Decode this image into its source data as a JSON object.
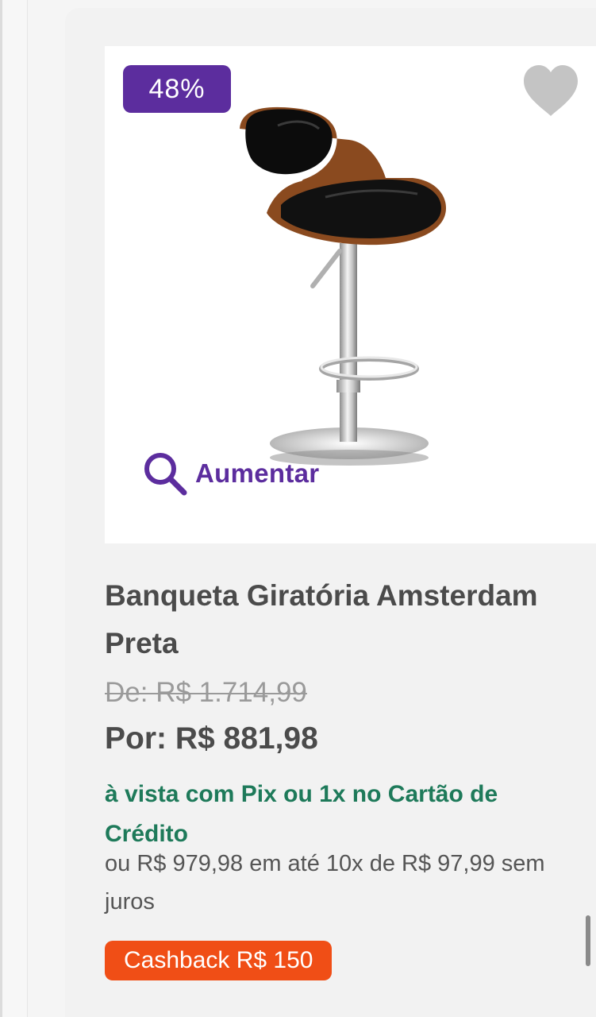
{
  "product": {
    "discount_badge": "48%",
    "zoom_label": "Aumentar",
    "title": "Banqueta Giratória Amsterdam Preta",
    "price_from": "De: R$ 1.714,99",
    "price_to": "Por: R$ 881,98",
    "pix_text": "à vista com Pix ou 1x no Cartão de Crédito",
    "installments_text": "ou R$ 979,98 em até 10x de R$ 97,99 sem juros",
    "cashback": "Cashback R$ 150"
  },
  "icons": {
    "favorite": "heart-icon",
    "zoom": "magnifier-icon"
  },
  "colors": {
    "badge_bg": "#5c2d9e",
    "pix_text": "#1e7a5a",
    "cashback_bg": "#f04e16",
    "heart": "#c4c4c4"
  }
}
